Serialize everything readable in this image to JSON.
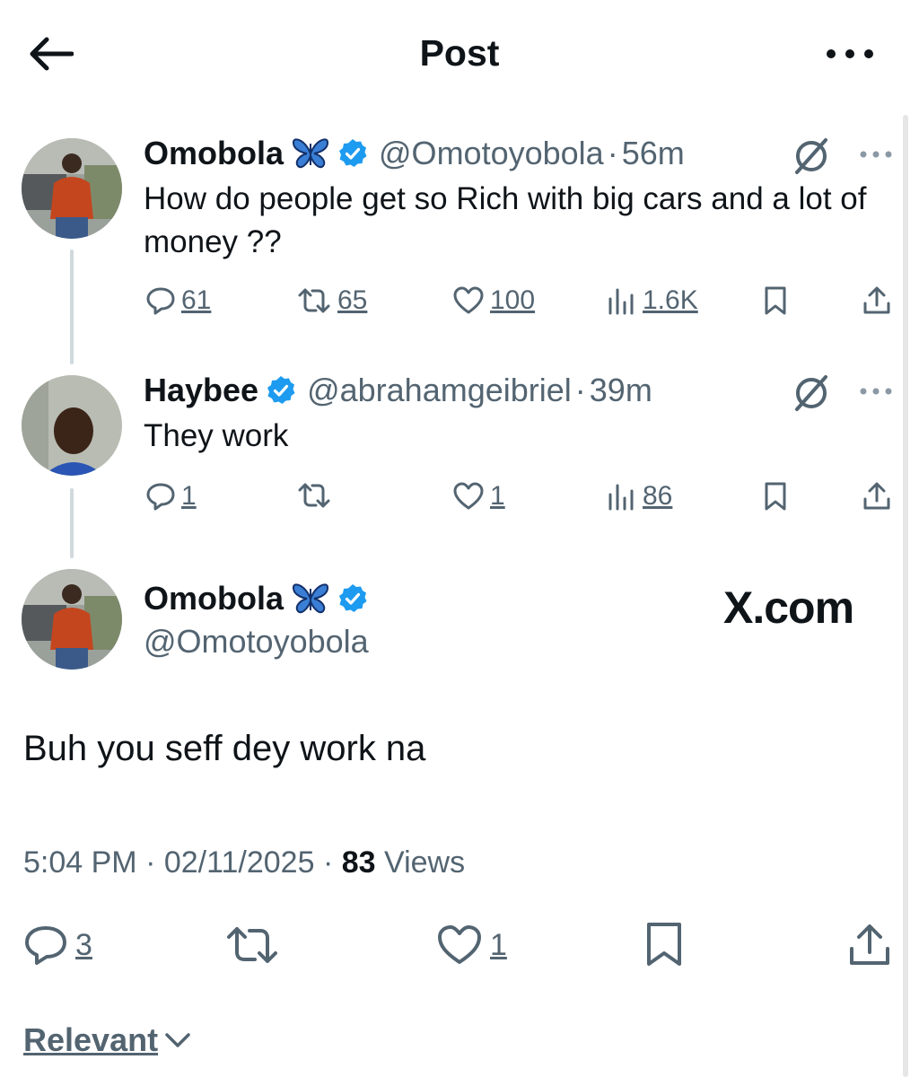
{
  "header": {
    "title": "Post"
  },
  "thread": [
    {
      "name": "Omobola",
      "handle": "@Omotoyobola",
      "time": "56m",
      "text": "How do people get so Rich with big cars and a lot of money ??",
      "replies": "61",
      "reposts": "65",
      "likes": "100",
      "views": "1.6K"
    },
    {
      "name": "Haybee",
      "handle": "@abrahamgeibriel",
      "time": "39m",
      "text": "They work",
      "replies": "1",
      "reposts": "",
      "likes": "1",
      "views": "86"
    }
  ],
  "main_post": {
    "name": "Omobola",
    "handle": "@Omotoyobola",
    "watermark": "X.com",
    "text": "Buh you seff dey work na",
    "time": "5:04 PM",
    "date": "02/11/2025",
    "views_count": "83",
    "views_label": "Views",
    "replies": "3",
    "likes": "1"
  },
  "sort": {
    "label": "Relevant"
  },
  "separator": "·",
  "colors": {
    "verified": "#1d9bf0",
    "secondary": "#536471",
    "text": "#0f1419",
    "butterfly": "#3a7fd5"
  },
  "icons": [
    "back-arrow-icon",
    "more-icon",
    "verified-icon",
    "butterfly-icon",
    "grok-icon",
    "reply-icon",
    "repost-icon",
    "like-icon",
    "views-icon",
    "bookmark-icon",
    "share-icon",
    "chevron-down-icon"
  ]
}
